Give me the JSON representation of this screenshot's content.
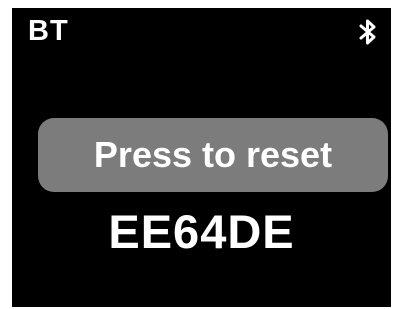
{
  "header": {
    "title": "BT",
    "status_icon": "bluetooth-icon"
  },
  "main": {
    "reset_button_label": "Press to reset",
    "device_code": "EE64DE"
  },
  "colors": {
    "screen_background": "#000000",
    "text": "#ffffff",
    "button_background": "#7c7c7c"
  }
}
